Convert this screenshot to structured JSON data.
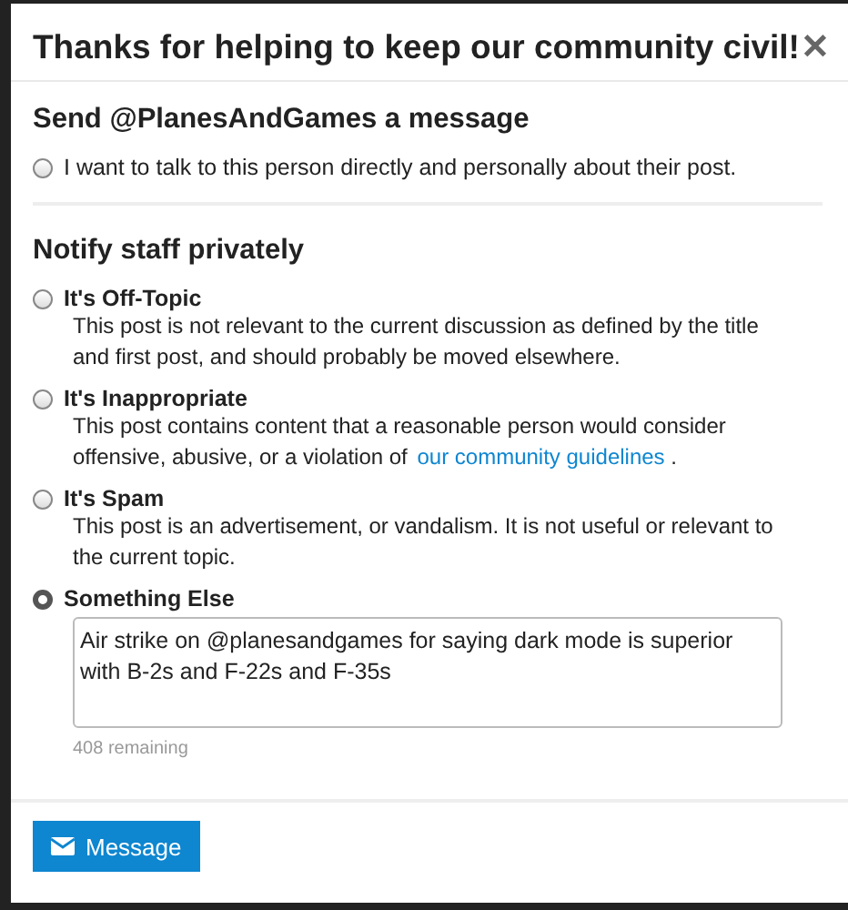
{
  "modal": {
    "title": "Thanks for helping to keep our community civil!",
    "close": "✕"
  },
  "message_section": {
    "heading": "Send @PlanesAndGames a message",
    "option": {
      "label": "I want to talk to this person directly and personally about their post.",
      "selected": false
    }
  },
  "notify_section": {
    "heading": "Notify staff privately",
    "options": [
      {
        "kind": "plain",
        "title": "It's Off-Topic",
        "description": "This post is not relevant to the current discussion as defined by the title and first post, and should probably be moved elsewhere.",
        "selected": false
      },
      {
        "kind": "link",
        "title": "It's Inappropriate",
        "description": "This post contains content that a reasonable person would consider offensive, abusive, or a violation of",
        "link": "our community guidelines",
        "description_end": ".",
        "selected": false
      },
      {
        "kind": "plain",
        "title": "It's Spam",
        "description": "This post is an advertisement, or vandalism. It is not useful or relevant to the current topic.",
        "selected": false
      },
      {
        "kind": "input",
        "title": "Something Else",
        "value": "Air strike on @planesandgames for saying dark mode is superior with B-2s and F-22s and F-35s",
        "remaining": "408 remaining",
        "selected": true
      }
    ]
  },
  "footer": {
    "button": "Message"
  }
}
